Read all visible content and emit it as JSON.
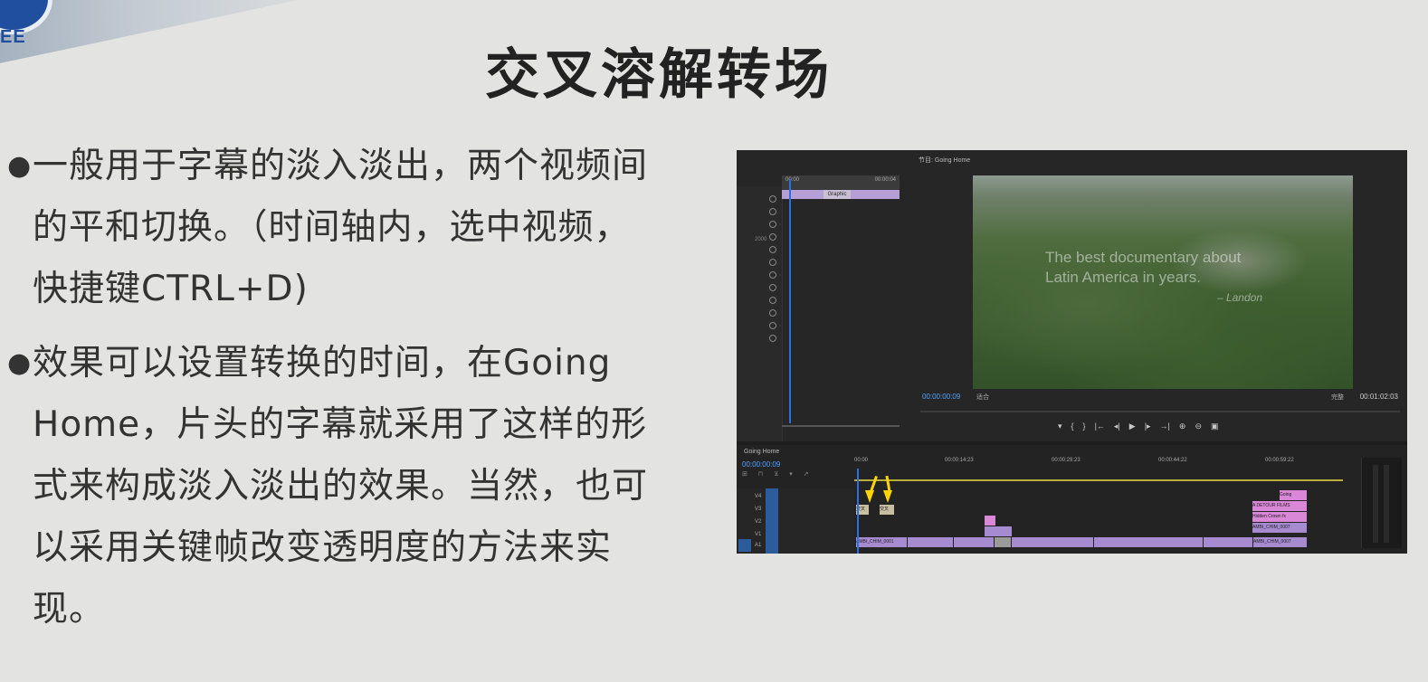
{
  "slide": {
    "logo_text": "EE",
    "title": "交叉溶解转场",
    "bullets": [
      "一般用于字幕的淡入淡出，两个视频间的平和切换。（时间轴内，选中视频，快捷键CTRL+D)",
      "效果可以设置转换的时间，在Going Home，片头的字幕就采用了这样的形式来构成淡入淡出的效果。当然，也可以采用关键帧改变透明度的方法来实现。"
    ],
    "bullet_symbol": "●"
  },
  "editor": {
    "source_clip_label": "Graphic",
    "source_timecode": "00:00:04",
    "source_timecode_start": "00:00",
    "source_mid_label": "2000",
    "monitor_tab": "节目: Going Home",
    "caption_line1": "The best documentary about",
    "caption_line2": "Latin America in years.",
    "caption_sig": "– Landon",
    "timecode_current": "00:00:00:09",
    "fit_label": "适合",
    "quality_label": "完整",
    "timecode_duration": "00:01:02:03",
    "transport_icons": [
      "▾",
      "{",
      "}",
      "|←",
      "◂|",
      "▶",
      "|▸",
      "→|",
      "⊕",
      "⊖",
      "▣"
    ],
    "timeline_tab": "Going Home",
    "timeline_timecode": "00:00:00:09",
    "timeline_tools": "⊞ ⊓ ⊻ ▾ ↗",
    "ruler_labels": [
      "00:00",
      "00:00:14:23",
      "00:00:29:23",
      "00:00:44:22",
      "00:00:59:22"
    ],
    "track_labels": [
      "V4",
      "V3",
      "V2",
      "V1",
      "A1"
    ],
    "clips": {
      "dissolve_a": "交叉",
      "dissolve_b": "交叉",
      "end_1": "Going",
      "end_2": "A DETOUR FILMS",
      "end_3": "Hidden Crown fx",
      "end_4": "AMBI_CHIM_0007",
      "end_5": "AMBI_CHIM_0007",
      "v1_first": "AMBI_CHIM_0001"
    },
    "accent": "#2d6fe0",
    "arrow_color": "#ffd400"
  }
}
